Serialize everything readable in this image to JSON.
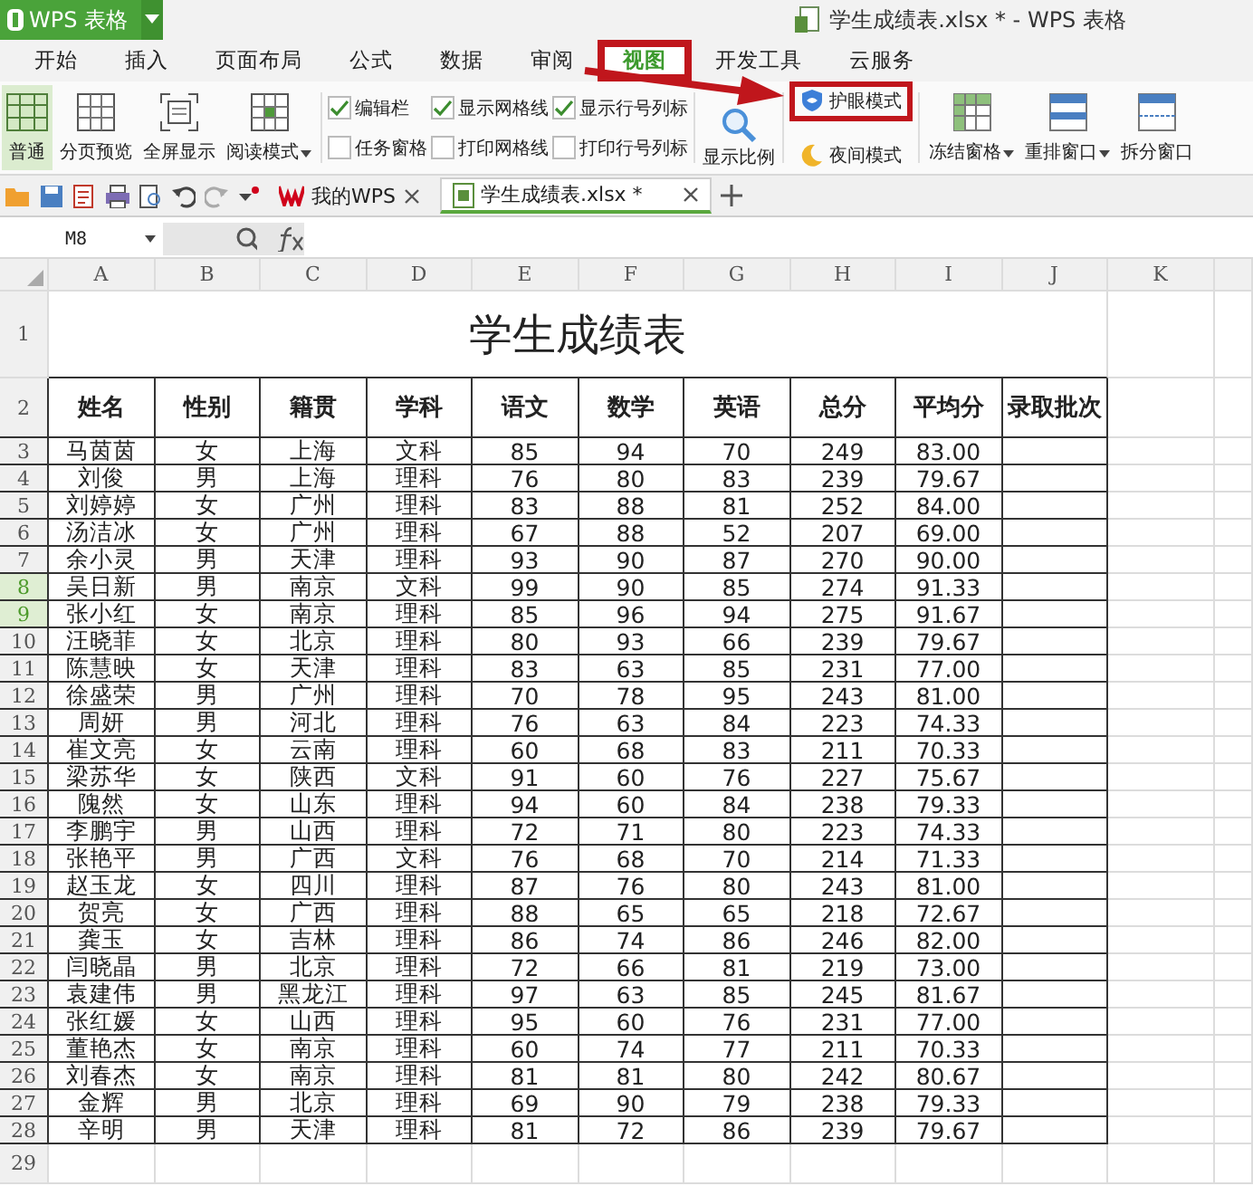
{
  "app_button": {
    "label": "WPS 表格"
  },
  "window": {
    "title": "学生成绩表.xlsx * - WPS 表格"
  },
  "menu_tabs": [
    {
      "label": "开始",
      "selected": false,
      "highlighted": false
    },
    {
      "label": "插入",
      "selected": false,
      "highlighted": false
    },
    {
      "label": "页面布局",
      "selected": false,
      "highlighted": false
    },
    {
      "label": "公式",
      "selected": false,
      "highlighted": false
    },
    {
      "label": "数据",
      "selected": false,
      "highlighted": false
    },
    {
      "label": "审阅",
      "selected": false,
      "highlighted": false
    },
    {
      "label": "视图",
      "selected": true,
      "highlighted": true
    },
    {
      "label": "开发工具",
      "selected": false,
      "highlighted": false
    },
    {
      "label": "云服务",
      "selected": false,
      "highlighted": false
    }
  ],
  "callout_arrow": true,
  "ribbon": {
    "view_buttons": [
      {
        "label": "普通",
        "kind": "normal",
        "selected": true,
        "dropdown": false
      },
      {
        "label": "分页预览",
        "kind": "pagebreak",
        "selected": false,
        "dropdown": false
      },
      {
        "label": "全屏显示",
        "kind": "fullscreen",
        "selected": false,
        "dropdown": false
      },
      {
        "label": "阅读模式",
        "kind": "reading",
        "selected": false,
        "dropdown": true
      }
    ],
    "checkbox_columns": [
      [
        {
          "label": "编辑栏",
          "checked": true
        },
        {
          "label": "任务窗格",
          "checked": false
        }
      ],
      [
        {
          "label": "显示网格线",
          "checked": true
        },
        {
          "label": "打印网格线",
          "checked": false
        }
      ],
      [
        {
          "label": "显示行号列标",
          "checked": true
        },
        {
          "label": "打印行号列标",
          "checked": false
        }
      ]
    ],
    "zoom_button": {
      "label": "显示比例"
    },
    "mode_buttons": [
      {
        "label": "护眼模式",
        "kind": "eye",
        "highlighted": true
      },
      {
        "label": "夜间模式",
        "kind": "night",
        "highlighted": false
      }
    ],
    "window_buttons": [
      {
        "label": "冻结窗格",
        "kind": "freeze",
        "dropdown": true
      },
      {
        "label": "重排窗口",
        "kind": "arrange",
        "dropdown": true
      },
      {
        "label": "拆分窗口",
        "kind": "split",
        "dropdown": false
      }
    ]
  },
  "doc_tabs": [
    {
      "label": "我的WPS",
      "kind": "home",
      "selected": false
    },
    {
      "label": "学生成绩表.xlsx *",
      "kind": "sheet",
      "selected": true
    }
  ],
  "formula_bar": {
    "name_box": "M8"
  },
  "sheet": {
    "columns": [
      "A",
      "B",
      "C",
      "D",
      "E",
      "F",
      "G",
      "H",
      "I",
      "J",
      "K"
    ],
    "rows": [
      {
        "number": "1",
        "kind": "title",
        "selected": false,
        "title": "学生成绩表"
      },
      {
        "number": "2",
        "kind": "header",
        "selected": false,
        "cells": [
          "姓名",
          "性别",
          "籍贯",
          "学科",
          "语文",
          "数学",
          "英语",
          "总分",
          "平均分",
          "录取批次"
        ]
      },
      {
        "number": "3",
        "kind": "data",
        "selected": false,
        "cells": [
          "马茵茵",
          "女",
          "上海",
          "文科",
          "85",
          "94",
          "70",
          "249",
          "83.00"
        ]
      },
      {
        "number": "4",
        "kind": "data",
        "selected": false,
        "cells": [
          "刘俊",
          "男",
          "上海",
          "理科",
          "76",
          "80",
          "83",
          "239",
          "79.67"
        ]
      },
      {
        "number": "5",
        "kind": "data",
        "selected": false,
        "cells": [
          "刘婷婷",
          "女",
          "广州",
          "理科",
          "83",
          "88",
          "81",
          "252",
          "84.00"
        ]
      },
      {
        "number": "6",
        "kind": "data",
        "selected": false,
        "cells": [
          "汤洁冰",
          "女",
          "广州",
          "理科",
          "67",
          "88",
          "52",
          "207",
          "69.00"
        ]
      },
      {
        "number": "7",
        "kind": "data",
        "selected": false,
        "cells": [
          "余小灵",
          "男",
          "天津",
          "理科",
          "93",
          "90",
          "87",
          "270",
          "90.00"
        ]
      },
      {
        "number": "8",
        "kind": "data",
        "selected": true,
        "cells": [
          "吴日新",
          "男",
          "南京",
          "文科",
          "99",
          "90",
          "85",
          "274",
          "91.33"
        ]
      },
      {
        "number": "9",
        "kind": "data",
        "selected": true,
        "cells": [
          "张小红",
          "女",
          "南京",
          "理科",
          "85",
          "96",
          "94",
          "275",
          "91.67"
        ]
      },
      {
        "number": "10",
        "kind": "data",
        "selected": false,
        "cells": [
          "汪晓菲",
          "女",
          "北京",
          "理科",
          "80",
          "93",
          "66",
          "239",
          "79.67"
        ]
      },
      {
        "number": "11",
        "kind": "data",
        "selected": false,
        "cells": [
          "陈慧映",
          "女",
          "天津",
          "理科",
          "83",
          "63",
          "85",
          "231",
          "77.00"
        ]
      },
      {
        "number": "12",
        "kind": "data",
        "selected": false,
        "cells": [
          "徐盛荣",
          "男",
          "广州",
          "理科",
          "70",
          "78",
          "95",
          "243",
          "81.00"
        ]
      },
      {
        "number": "13",
        "kind": "data",
        "selected": false,
        "cells": [
          "周妍",
          "男",
          "河北",
          "理科",
          "76",
          "63",
          "84",
          "223",
          "74.33"
        ]
      },
      {
        "number": "14",
        "kind": "data",
        "selected": false,
        "cells": [
          "崔文亮",
          "女",
          "云南",
          "理科",
          "60",
          "68",
          "83",
          "211",
          "70.33"
        ]
      },
      {
        "number": "15",
        "kind": "data",
        "selected": false,
        "cells": [
          "梁苏华",
          "女",
          "陕西",
          "文科",
          "91",
          "60",
          "76",
          "227",
          "75.67"
        ]
      },
      {
        "number": "16",
        "kind": "data",
        "selected": false,
        "cells": [
          "隗然",
          "女",
          "山东",
          "理科",
          "94",
          "60",
          "84",
          "238",
          "79.33"
        ]
      },
      {
        "number": "17",
        "kind": "data",
        "selected": false,
        "cells": [
          "李鹏宇",
          "男",
          "山西",
          "理科",
          "72",
          "71",
          "80",
          "223",
          "74.33"
        ]
      },
      {
        "number": "18",
        "kind": "data",
        "selected": false,
        "cells": [
          "张艳平",
          "男",
          "广西",
          "文科",
          "76",
          "68",
          "70",
          "214",
          "71.33"
        ]
      },
      {
        "number": "19",
        "kind": "data",
        "selected": false,
        "cells": [
          "赵玉龙",
          "女",
          "四川",
          "理科",
          "87",
          "76",
          "80",
          "243",
          "81.00"
        ]
      },
      {
        "number": "20",
        "kind": "data",
        "selected": false,
        "cells": [
          "贺亮",
          "女",
          "广西",
          "理科",
          "88",
          "65",
          "65",
          "218",
          "72.67"
        ]
      },
      {
        "number": "21",
        "kind": "data",
        "selected": false,
        "cells": [
          "龚玉",
          "女",
          "吉林",
          "理科",
          "86",
          "74",
          "86",
          "246",
          "82.00"
        ]
      },
      {
        "number": "22",
        "kind": "data",
        "selected": false,
        "cells": [
          "闫晓晶",
          "男",
          "北京",
          "理科",
          "72",
          "66",
          "81",
          "219",
          "73.00"
        ]
      },
      {
        "number": "23",
        "kind": "data",
        "selected": false,
        "cells": [
          "袁建伟",
          "男",
          "黑龙江",
          "理科",
          "97",
          "63",
          "85",
          "245",
          "81.67"
        ]
      },
      {
        "number": "24",
        "kind": "data",
        "selected": false,
        "cells": [
          "张红媛",
          "女",
          "山西",
          "理科",
          "95",
          "60",
          "76",
          "231",
          "77.00"
        ]
      },
      {
        "number": "25",
        "kind": "data",
        "selected": false,
        "cells": [
          "董艳杰",
          "女",
          "南京",
          "理科",
          "60",
          "74",
          "77",
          "211",
          "70.33"
        ]
      },
      {
        "number": "26",
        "kind": "data",
        "selected": false,
        "cells": [
          "刘春杰",
          "女",
          "南京",
          "理科",
          "81",
          "81",
          "80",
          "242",
          "80.67"
        ]
      },
      {
        "number": "27",
        "kind": "data",
        "selected": false,
        "cells": [
          "金辉",
          "男",
          "北京",
          "理科",
          "69",
          "90",
          "79",
          "238",
          "79.33"
        ]
      },
      {
        "number": "28",
        "kind": "data",
        "selected": false,
        "cells": [
          "辛明",
          "男",
          "天津",
          "理科",
          "81",
          "72",
          "86",
          "239",
          "79.67"
        ]
      },
      {
        "number": "29",
        "kind": "blank",
        "selected": false
      }
    ]
  }
}
